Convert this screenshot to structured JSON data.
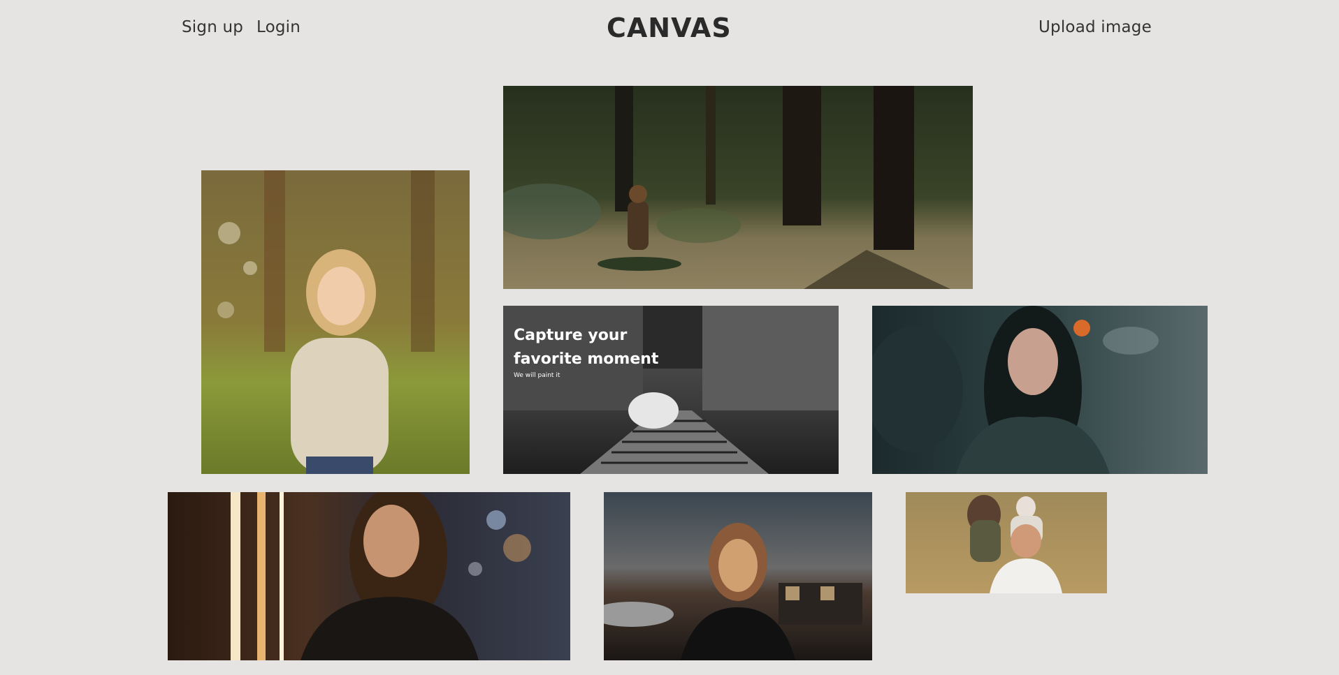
{
  "header": {
    "signup_label": "Sign up",
    "login_label": "Login",
    "logo": "CANVAS",
    "upload_label": "Upload image"
  },
  "promo": {
    "title_line1": "Capture your",
    "title_line2": "favorite moment",
    "subtitle": "We will paint it"
  },
  "gallery": [
    {
      "id": "forest",
      "alt": "child sitting in forest"
    },
    {
      "id": "girl",
      "alt": "smiling little girl"
    },
    {
      "id": "umbrella",
      "alt": "umbrella on steps"
    },
    {
      "id": "woman",
      "alt": "woman in rain"
    },
    {
      "id": "man",
      "alt": "man with glasses"
    },
    {
      "id": "sunset",
      "alt": "woman at sunset"
    },
    {
      "id": "family",
      "alt": "family portrait"
    }
  ]
}
